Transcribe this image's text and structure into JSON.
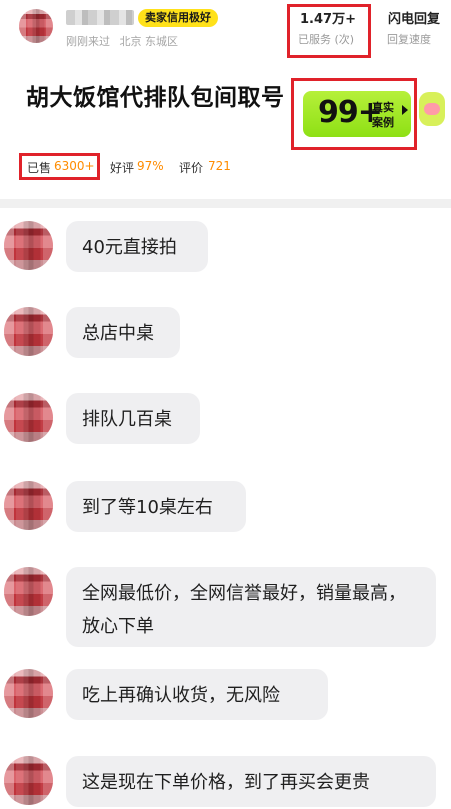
{
  "seller": {
    "credit_badge": "卖家信用极好",
    "last_seen": "刚刚来过",
    "location": "北京 东城区",
    "served_value": "1.47万+",
    "served_label": "已服务 (次)",
    "reply_value": "闪电回复",
    "reply_label": "回复速度"
  },
  "product": {
    "title": "胡大饭馆代排队包间取号",
    "sold_label": "已售",
    "sold_value": "6300+",
    "good_rating_label": "好评",
    "good_rating_value": "97%",
    "review_label": "评价",
    "review_value": "721",
    "cases_number": "99+",
    "cases_line1": "真实",
    "cases_line2": "案例"
  },
  "colors": {
    "highlight_red": "#e0222a",
    "accent_orange": "#ff8c00",
    "badge_yellow": "#ffe11a",
    "cases_green": "#9be41f",
    "bubble_gray": "#efeff1"
  },
  "messages": [
    {
      "text": "40元直接拍"
    },
    {
      "text": "总店中桌"
    },
    {
      "text": "排队几百桌"
    },
    {
      "text": "到了等10桌左右"
    },
    {
      "text": "全网最低价，全网信誉最好，销量最高，放心下单"
    },
    {
      "text": "吃上再确认收货，无风险"
    },
    {
      "text": "这是现在下单价格，到了再买会更贵"
    }
  ]
}
